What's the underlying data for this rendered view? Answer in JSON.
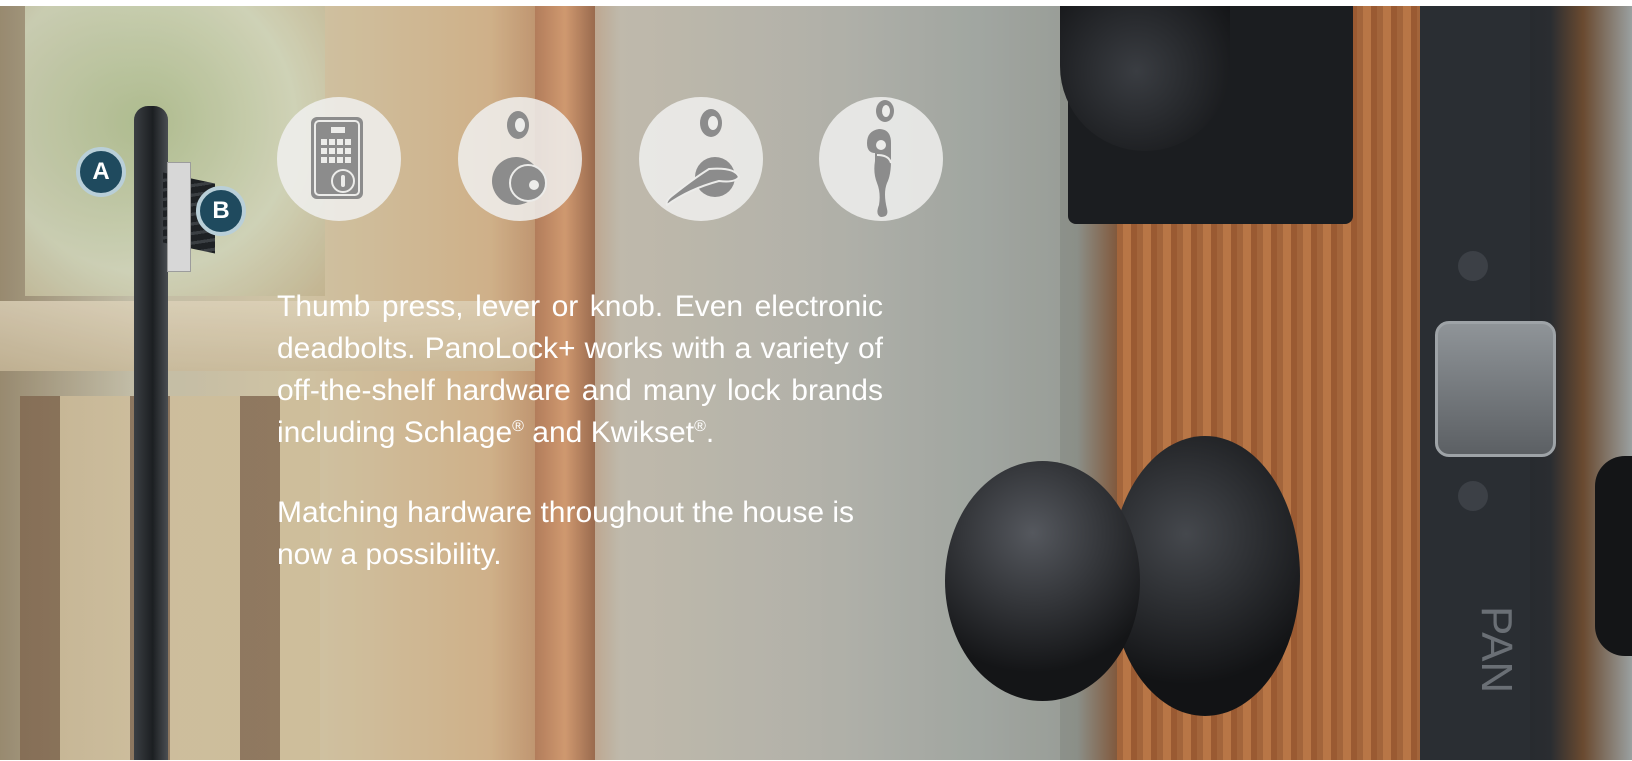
{
  "hero": {
    "callouts": {
      "a": "A",
      "b": "B"
    },
    "icons": [
      {
        "name": "keypad-deadbolt-icon"
      },
      {
        "name": "knob-deadbolt-icon"
      },
      {
        "name": "lever-deadbolt-icon"
      },
      {
        "name": "handleset-icon"
      }
    ],
    "paragraph1": {
      "text": "Thumb press, lever or knob. Even electronic deadbolts. PanoLock+ works with a variety of off-the-shelf hardware and many lock brands including Schlage",
      "mark1": "®",
      "text2": " and Kwikset",
      "mark2": "®",
      "text3": "."
    },
    "paragraph2": "Matching hardware throughout the house is now a possibility.",
    "door_strip_text": "PAN"
  },
  "colors": {
    "callout_fill": "#1f4a5e",
    "callout_ring": "#b9cfd8",
    "icon_fill": "#8c8c8c",
    "text": "#ffffff"
  }
}
